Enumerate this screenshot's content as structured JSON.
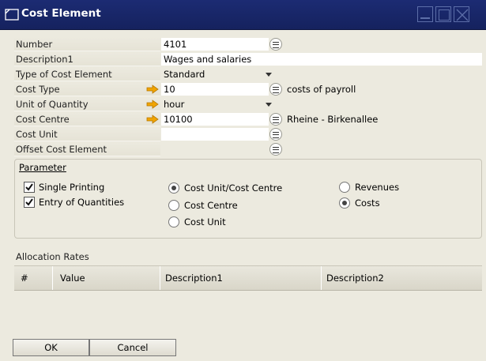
{
  "window": {
    "title": "Cost Element",
    "controls": [
      "minimize",
      "maximize",
      "close"
    ]
  },
  "fields": [
    {
      "label": "Number",
      "value": "4101",
      "has_lookup": true
    },
    {
      "label": "Description1",
      "value": "Wages and salaries"
    },
    {
      "label": "Type of Cost Element",
      "value": "Standard",
      "dropdown": true
    },
    {
      "label": "Cost Type",
      "value": "10",
      "has_link_arrow": true,
      "has_lookup": true,
      "description": "costs of payroll"
    },
    {
      "label": "Unit of Quantity",
      "value": "hour",
      "has_link_arrow": true,
      "dropdown": true
    },
    {
      "label": "Cost Centre",
      "value": "10100",
      "has_link_arrow": true,
      "has_lookup": true,
      "description": "Rheine - Birkenallee"
    },
    {
      "label": "Cost Unit",
      "value": "",
      "has_lookup": true,
      "description": ""
    },
    {
      "label": "Offset Cost Element",
      "value": "",
      "has_lookup": true,
      "description": ""
    }
  ],
  "parameter": {
    "title": "Parameter",
    "checkboxes": [
      {
        "label": "Single Printing",
        "checked": true
      },
      {
        "label": "Entry of Quantities",
        "checked": true
      }
    ],
    "assignment_radios": [
      {
        "label": "Cost Unit/Cost Centre",
        "selected": true
      },
      {
        "label": "Cost Centre",
        "selected": false
      },
      {
        "label": "Cost Unit",
        "selected": false
      }
    ],
    "type_radios": [
      {
        "label": "Revenues",
        "selected": false
      },
      {
        "label": "Costs",
        "selected": true
      }
    ]
  },
  "allocation": {
    "title": "Allocation Rates",
    "columns": [
      "#",
      "Value",
      "Description1",
      "Description2"
    ]
  },
  "buttons": {
    "ok": "OK",
    "cancel": "Cancel"
  },
  "colors": {
    "titlebar": "#1c2b73",
    "panel": "#eceadf",
    "link_arrow": "#f0a400"
  }
}
